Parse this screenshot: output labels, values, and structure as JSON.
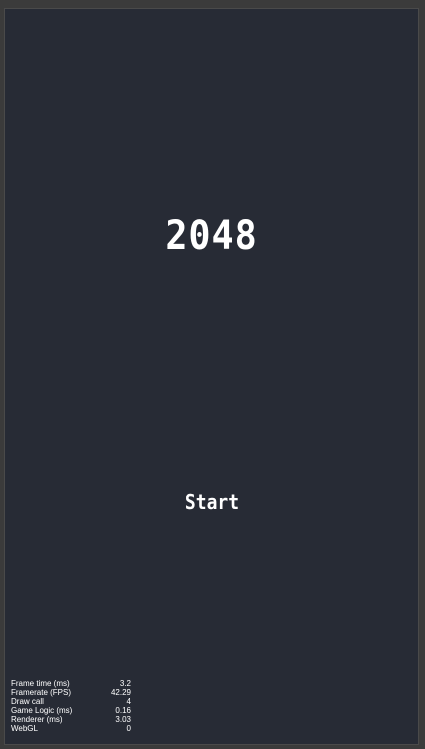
{
  "game": {
    "title": "2048",
    "start_label": "Start"
  },
  "stats": [
    {
      "label": "Frame time (ms)",
      "value": "3.2"
    },
    {
      "label": "Framerate (FPS)",
      "value": "42.29"
    },
    {
      "label": "Draw call",
      "value": "4"
    },
    {
      "label": "Game Logic (ms)",
      "value": "0.16"
    },
    {
      "label": "Renderer (ms)",
      "value": "3.03"
    },
    {
      "label": "WebGL",
      "value": "0"
    }
  ],
  "colors": {
    "background": "#272b35",
    "outer": "#3b3b3b",
    "text": "#ffffff"
  }
}
